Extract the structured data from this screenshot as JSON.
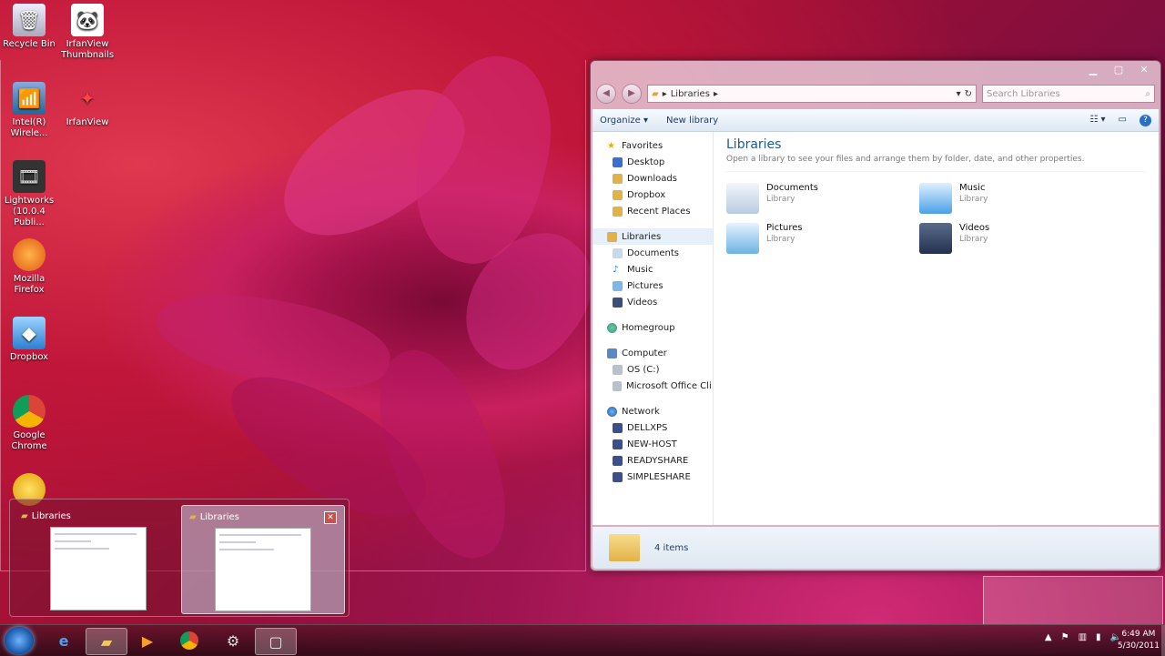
{
  "desktop_icons": [
    {
      "label": "Recycle Bin",
      "icon": "recycle-bin-icon"
    },
    {
      "label": "IrfanView Thumbnails",
      "icon": "panda-icon"
    },
    {
      "label": "Intel(R) Wirele...",
      "icon": "wireless-icon"
    },
    {
      "label": "IrfanView",
      "icon": "irfanview-icon"
    },
    {
      "label": "Lightworks (10.0.4 Publi...",
      "icon": "lightworks-icon"
    },
    {
      "label": "Mozilla Firefox",
      "icon": "firefox-icon"
    },
    {
      "label": "Dropbox",
      "icon": "dropbox-icon"
    },
    {
      "label": "Google Chrome",
      "icon": "chrome-icon"
    }
  ],
  "window": {
    "address": "Libraries",
    "search_placeholder": "Search Libraries",
    "toolbar": {
      "organize": "Organize",
      "new_library": "New library"
    },
    "nav": {
      "favorites": "Favorites",
      "favorites_items": [
        "Desktop",
        "Downloads",
        "Dropbox",
        "Recent Places"
      ],
      "libraries": "Libraries",
      "libraries_items": [
        "Documents",
        "Music",
        "Pictures",
        "Videos"
      ],
      "homegroup": "Homegroup",
      "computer": "Computer",
      "computer_items": [
        "OS (C:)",
        "Microsoft Office Cli..."
      ],
      "network": "Network",
      "network_items": [
        "DELLXPS",
        "NEW-HOST",
        "READYSHARE",
        "SIMPLESHARE"
      ]
    },
    "main": {
      "title": "Libraries",
      "subtitle": "Open a library to see your files and arrange them by folder, date, and other properties.",
      "libraries": [
        {
          "name": "Documents",
          "type": "Library"
        },
        {
          "name": "Music",
          "type": "Library"
        },
        {
          "name": "Pictures",
          "type": "Library"
        },
        {
          "name": "Videos",
          "type": "Library"
        }
      ]
    },
    "status": "4 items"
  },
  "thumbnails": [
    {
      "title": "Libraries"
    },
    {
      "title": "Libraries"
    }
  ],
  "clock": {
    "time": "6:49 AM",
    "date": "5/30/2011"
  }
}
